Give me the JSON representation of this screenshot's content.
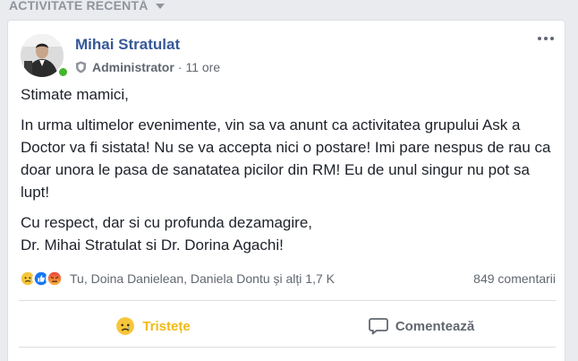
{
  "section": {
    "title": "ACTIVITATE RECENTĂ",
    "caret_icon": "caret-down-icon"
  },
  "post": {
    "author": "Mihai Stratulat",
    "role": "Administrator",
    "separator": "·",
    "time": "11 ore",
    "avatar_icon": "profile-photo",
    "role_icon": "shield-icon",
    "more_icon": "more-options-icon",
    "paragraphs": [
      "Stimate mamici,",
      "In urma ultimelor evenimente, vin sa va anunt ca activitatea grupului Ask a Doctor va fi sistata! Nu se va accepta nici o postare! Imi pare nespus de rau ca doar unora le pasa de sanatatea picilor din RM! Eu de unul singur nu pot sa lupt!",
      "Cu respect, dar si cu profunda dezamagire,",
      "Dr. Mihai Stratulat si Dr. Dorina Agachi!"
    ]
  },
  "reactions": {
    "icons": [
      "sad-reaction-icon",
      "like-reaction-icon",
      "angry-reaction-icon"
    ],
    "summary": "Tu, Doina Danielean, Daniela Dontu și alți 1,7 K",
    "comments": "849 comentarii"
  },
  "actions": {
    "reaction_label": "Tristețe",
    "comment_label": "Comentează"
  },
  "colors": {
    "background": "#e9ebee",
    "link": "#365899",
    "sad_active": "#f0ba15",
    "muted": "#616770",
    "online": "#42b72a"
  }
}
